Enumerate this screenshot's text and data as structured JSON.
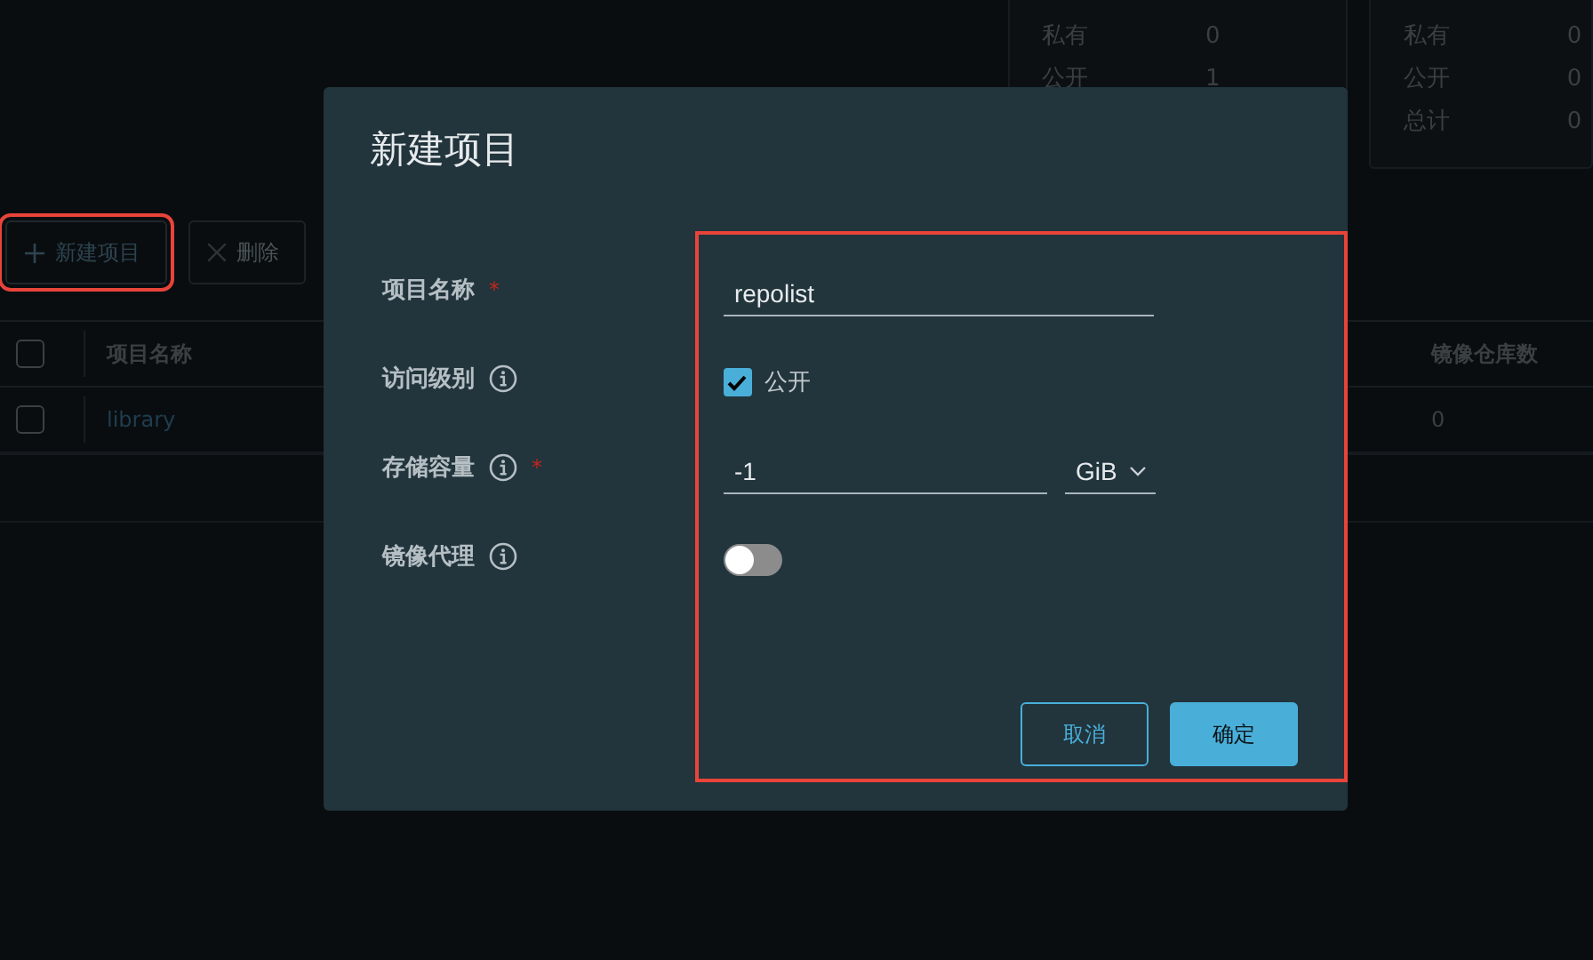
{
  "stats": [
    {
      "rows": [
        {
          "label": "私有",
          "value": "0"
        },
        {
          "label": "公开",
          "value": "1"
        }
      ]
    },
    {
      "rows": [
        {
          "label": "私有",
          "value": "0"
        },
        {
          "label": "公开",
          "value": "0"
        },
        {
          "label": "总计",
          "value": "0"
        }
      ]
    }
  ],
  "toolbar": {
    "buttons": [
      {
        "kind": "add",
        "label": "新建项目",
        "highlighted": true
      },
      {
        "kind": "delete",
        "label": "删除"
      }
    ]
  },
  "table": {
    "columns": [
      "项目名称",
      "镜像仓库数"
    ],
    "all_selected": false,
    "rows": [
      {
        "name": "library",
        "repo_count": "0",
        "selected": false
      }
    ]
  },
  "dialog": {
    "title": "新建项目",
    "form_highlighted": true,
    "fields": [
      {
        "kind": "text",
        "label": "项目名称",
        "info": false,
        "required_mark": "*",
        "value": "repolist"
      },
      {
        "kind": "checkbox",
        "label": "访问级别",
        "info": true,
        "checked": true,
        "option": "公开"
      },
      {
        "kind": "quota",
        "label": "存储容量",
        "info": true,
        "required_mark": "*",
        "value": "-1",
        "unit": "GiB"
      },
      {
        "kind": "toggle",
        "label": "镜像代理",
        "info": true,
        "on": false
      }
    ],
    "buttons": [
      {
        "kind": "secondary",
        "label": "取消"
      },
      {
        "kind": "primary",
        "label": "确定"
      }
    ]
  }
}
